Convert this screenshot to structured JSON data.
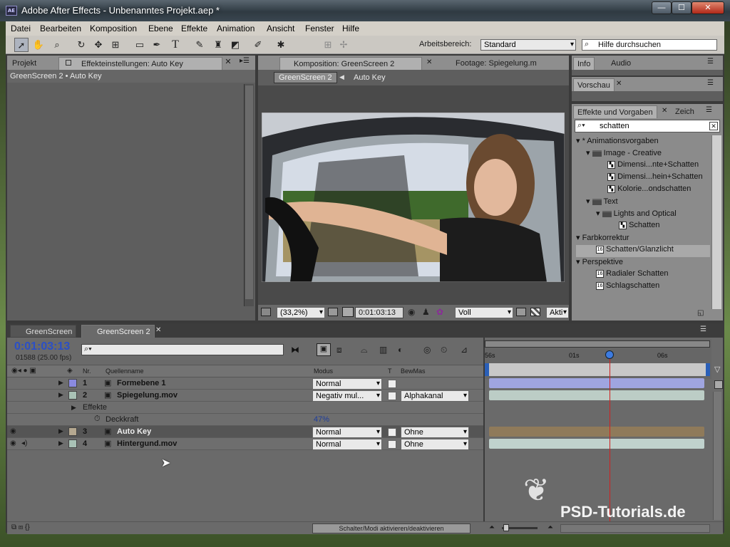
{
  "window": {
    "title": "Adobe After Effects - Unbenanntes Projekt.aep *",
    "app_icon": "AE",
    "min": "—",
    "max": "☐",
    "close": "✕"
  },
  "menu": [
    "Datei",
    "Bearbeiten",
    "Komposition",
    "Ebene",
    "Effekte",
    "Animation",
    "Ansicht",
    "Fenster",
    "Hilfe"
  ],
  "toolbar": {
    "icons": [
      "selection-tool-icon",
      "hand-tool-icon",
      "zoom-tool-icon",
      "rotate-tool-icon",
      "camera-tool-icon",
      "pan-behind-tool-icon",
      "rectangle-tool-icon",
      "pen-tool-icon",
      "text-tool-icon",
      "brush-tool-icon",
      "clone-stamp-tool-icon",
      "eraser-tool-icon",
      "roto-brush-icon",
      "puppet-pin-icon"
    ],
    "workspace_label": "Arbeitsbereich:",
    "workspace_value": "Standard",
    "search_placeholder": "Hilfe durchsuchen"
  },
  "left_panel": {
    "tabs": [
      "Projekt",
      "Effekteinstellungen: Auto Key"
    ],
    "breadcrumb": "GreenScreen 2 • Auto Key"
  },
  "comp_panel": {
    "tabs": [
      "Komposition: GreenScreen 2",
      "Footage: Spiegelung.m"
    ],
    "crumb": "GreenScreen 2",
    "crumb_next": "Auto Key",
    "zoom": "(33,2%)",
    "timecode": "0:01:03:13",
    "resolution": "Voll",
    "extra": "Akti"
  },
  "right_panels": {
    "info_tabs": [
      "Info",
      "Audio"
    ],
    "preview_tab": "Vorschau",
    "effects_tabs": [
      "Effekte und Vorgaben",
      "Zeich"
    ],
    "search_value": "schatten",
    "tree": [
      {
        "label": "* Animationsvorgaben",
        "level": 0,
        "kind": "group",
        "open": true
      },
      {
        "label": "Image - Creative",
        "level": 1,
        "kind": "folder",
        "open": true
      },
      {
        "label": "Dimensi...nte+Schatten",
        "level": 2,
        "kind": "preset"
      },
      {
        "label": "Dimensi...hein+Schatten",
        "level": 2,
        "kind": "preset"
      },
      {
        "label": "Kolorie...ondschatten",
        "level": 2,
        "kind": "preset"
      },
      {
        "label": "Text",
        "level": 1,
        "kind": "folder",
        "open": true
      },
      {
        "label": "Lights and Optical",
        "level": 2,
        "kind": "folder",
        "open": true
      },
      {
        "label": "Schatten",
        "level": 3,
        "kind": "preset"
      },
      {
        "label": "Farbkorrektur",
        "level": 0,
        "kind": "group",
        "open": true
      },
      {
        "label": "Schatten/Glanzlicht",
        "level": 1,
        "kind": "effect",
        "selected": true
      },
      {
        "label": "Perspektive",
        "level": 0,
        "kind": "group",
        "open": true
      },
      {
        "label": "Radialer Schatten",
        "level": 1,
        "kind": "effect"
      },
      {
        "label": "Schlagschatten",
        "level": 1,
        "kind": "effect"
      }
    ]
  },
  "timeline": {
    "tabs": [
      "GreenScreen",
      "GreenScreen 2"
    ],
    "timecode": "0:01:03:13",
    "frames": "01588 (25.00 fps)",
    "ruler": [
      "56s",
      "01s",
      "06s"
    ],
    "headers": {
      "nr": "Nr.",
      "source": "Quellenname",
      "mode": "Modus",
      "t": "T",
      "bewmas": "BewMas"
    },
    "layers": [
      {
        "nr": "1",
        "name": "Formebene 1",
        "mode": "Normal",
        "track": "",
        "color": "#8a8ae0",
        "bar": "#9fa5e0",
        "eye": false,
        "audio": false
      },
      {
        "nr": "2",
        "name": "Spiegelung.mov",
        "mode": "Negativ mul...",
        "track": "Alphakanal",
        "color": "#a9c2b6",
        "bar": "#bccdc6",
        "eye": false,
        "audio": false
      },
      {
        "nr": "3",
        "name": "Auto Key",
        "mode": "Normal",
        "track": "Ohne",
        "color": "#b5a890",
        "bar": "#8f7a5a",
        "eye": true,
        "audio": false,
        "selected": true
      },
      {
        "nr": "4",
        "name": "Hintergund.mov",
        "mode": "Normal",
        "track": "Ohne",
        "color": "#a9c2b6",
        "bar": "#c0d2cd",
        "eye": true,
        "audio": true
      }
    ],
    "sub_effects": "Effekte",
    "opacity_label": "Deckkraft",
    "opacity_value": "47%",
    "footer_button": "Schalter/Modi aktivieren/deaktivieren",
    "playhead_fraction": 0.56
  },
  "watermark": "PSD-Tutorials.de",
  "colors": {
    "panel": "#5e5e5e",
    "tab": "#8e8e8e",
    "accent": "#1e3d9c",
    "playhead": "#d02020"
  }
}
